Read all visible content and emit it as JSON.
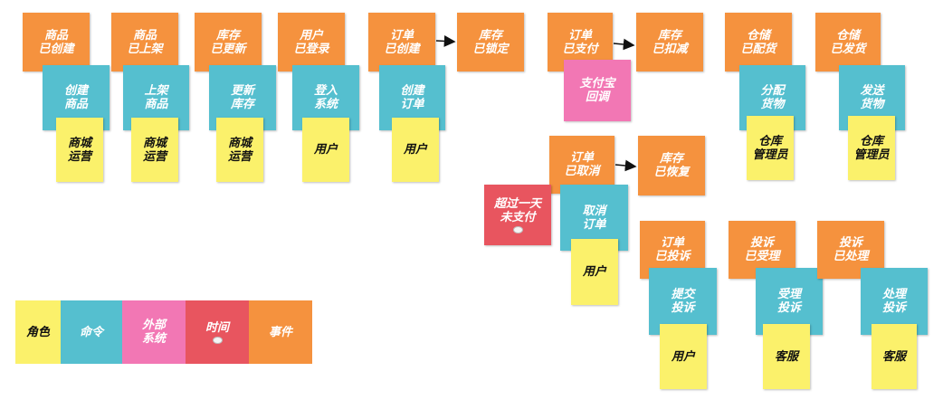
{
  "events": {
    "product_created": "商品\n已创建",
    "product_listed": "商品\n已上架",
    "stock_updated": "库存\n已更新",
    "user_logged_in": "用户\n已登录",
    "order_created": "订单\n已创建",
    "stock_locked": "库存\n已锁定",
    "order_paid": "订单\n已支付",
    "stock_deducted": "库存\n已扣减",
    "warehouse_allocated": "仓储\n已配货",
    "warehouse_shipped": "仓储\n已发货",
    "order_cancelled": "订单\n已取消",
    "stock_restored": "库存\n已恢复",
    "order_complained": "订单\n已投诉",
    "complaint_accepted": "投诉\n已受理",
    "complaint_handled": "投诉\n已处理"
  },
  "commands": {
    "create_product": "创建\n商品",
    "list_product": "上架\n商品",
    "update_stock": "更新\n库存",
    "login_system": "登入\n系统",
    "create_order": "创建\n订单",
    "allocate_goods": "分配\n货物",
    "ship_goods": "发送\n货物",
    "cancel_order": "取消\n订单",
    "submit_complaint": "提交\n投诉",
    "accept_complaint": "受理\n投诉",
    "handle_complaint": "处理\n投诉"
  },
  "roles": {
    "mall_ops": "商城\n运营",
    "user": "用户",
    "warehouse_manager": "仓库\n管理员",
    "customer_service": "客服"
  },
  "external": {
    "alipay_callback": "支付宝\n回调"
  },
  "timers": {
    "unpaid_one_day": "超过一天\n未支付"
  },
  "legend": {
    "role": "角色",
    "command": "命令",
    "external_system": "外部\n系统",
    "time": "时间",
    "event": "事件"
  },
  "colors": {
    "event": "#f5923e",
    "command": "#55bfcf",
    "role": "#fbf16b",
    "external": "#f277b4",
    "timer": "#e8555f"
  }
}
